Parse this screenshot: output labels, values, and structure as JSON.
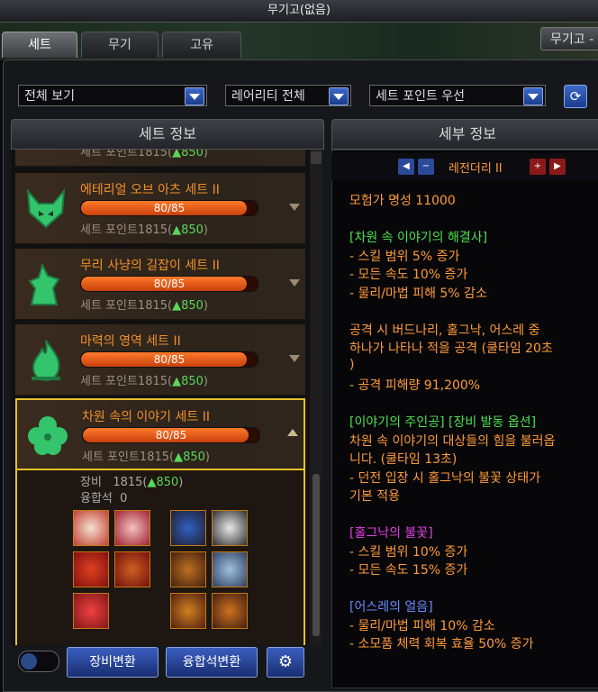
{
  "window": {
    "title": "무기고(없음)"
  },
  "tabs": [
    {
      "label": "세트",
      "active": true
    },
    {
      "label": "무기",
      "active": false
    },
    {
      "label": "고유",
      "active": false
    }
  ],
  "right_tab": "무기고 -",
  "filters": {
    "view": "전체 보기",
    "rarity": "레어리티 전체",
    "sort": "세트 포인트 우선"
  },
  "left_panel": {
    "title": "세트 정보"
  },
  "right_panel": {
    "title": "세부 정보",
    "level": "레전더리 II"
  },
  "sets": [
    {
      "name": "",
      "progress": "",
      "points": "세트 포인트1815(",
      "up": "▲850",
      ")": ")"
    },
    {
      "name": "에테리얼 오브 아츠 세트 II",
      "progress": "80/85",
      "points": "세트 포인트1815(",
      "up": "▲850",
      "close": ")"
    },
    {
      "name": "무리 사냥의 길잡이 세트 II",
      "progress": "80/85",
      "points": "세트 포인트1815(",
      "up": "▲850",
      "close": ")"
    },
    {
      "name": "마력의 영역 세트 II",
      "progress": "80/85",
      "points": "세트 포인트1815(",
      "up": "▲850",
      "close": ")"
    },
    {
      "name": "차원 속의 이야기 세트 II",
      "progress": "80/85",
      "points": "세트 포인트1815(",
      "up": "▲850",
      "close": ")"
    }
  ],
  "set_progress_fraction": 0.941,
  "equip": {
    "label": "장비",
    "value": "1815(",
    "up": "▲850",
    "close": ")",
    "fusion_label": "융합석",
    "fusion_value": "0"
  },
  "buttons": {
    "equip_change": "장비변환",
    "fusion_change": "융합석변환"
  },
  "details": [
    {
      "text": "모험가 명성 11000",
      "color": "#ff9a3a"
    },
    {
      "text": "",
      "color": "#fff"
    },
    {
      "text": "[차원 속 이야기의 해결사]",
      "color": "#4ee04e"
    },
    {
      "text": "- 스킬 범위 5% 증가",
      "color": "#ff9a3a"
    },
    {
      "text": "- 모든 속도 10% 증가",
      "color": "#ff9a3a"
    },
    {
      "text": "- 물리/마법 피해 5% 감소",
      "color": "#ff9a3a"
    },
    {
      "text": "",
      "color": "#fff"
    },
    {
      "text": "공격 시 버드나리, 홀그낙, 어스레 중",
      "color": "#ff9a3a"
    },
    {
      "text": "하나가 나타나 적을 공격 (쿨타임 20초",
      "color": "#ff9a3a"
    },
    {
      "text": ")",
      "color": "#ff9a3a"
    },
    {
      "text": "- 공격 피해량 91,200%",
      "color": "#ff9a3a"
    },
    {
      "text": "",
      "color": "#fff"
    },
    {
      "text": "[이야기의 주인공] [장비 발동 옵션]",
      "color": "#4ee04e"
    },
    {
      "text": "차원 속 이야기의 대상들의 힘을 불러옵",
      "color": "#ff9a3a"
    },
    {
      "text": "니다. (쿨타임 13초)",
      "color": "#ff9a3a"
    },
    {
      "text": "- 던전 입장 시 홀그낙의 불꽃 상태가",
      "color": "#ff9a3a"
    },
    {
      "text": "기본 적용",
      "color": "#ff9a3a"
    },
    {
      "text": "",
      "color": "#fff"
    },
    {
      "text": "[홀그낙의 불꽃]",
      "color": "#e040e0"
    },
    {
      "text": "- 스킬 범위 10% 증가",
      "color": "#ff9a3a"
    },
    {
      "text": "- 모든 속도 15% 증가",
      "color": "#ff9a3a"
    },
    {
      "text": "",
      "color": "#fff"
    },
    {
      "text": "[어스레의 얼음]",
      "color": "#6a8aff"
    },
    {
      "text": "- 물리/마법 피해 10% 감소",
      "color": "#ff9a3a"
    },
    {
      "text": "- 소모품 체력 회복 효율 50% 증가",
      "color": "#ff9a3a"
    }
  ]
}
